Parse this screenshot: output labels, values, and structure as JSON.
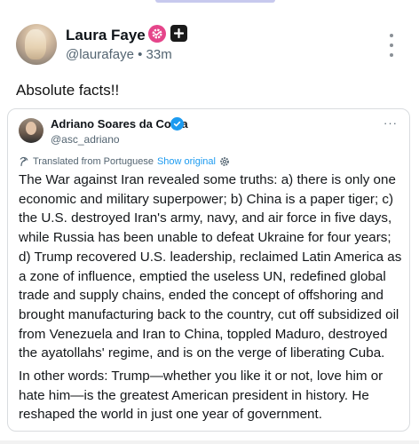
{
  "post": {
    "author_name": "Laura Faye",
    "handle": "@laurafaye",
    "separator": "•",
    "time_ago": "33m",
    "text": "Absolute facts!!",
    "icons": [
      "gear-badge-icon",
      "plus-box-icon",
      "more-vertical-icon"
    ]
  },
  "quote": {
    "author_name": "Adriano Soares da Costa",
    "handle": "@asc_adriano",
    "more": "···",
    "translated_label": "Translated from Portuguese",
    "show_original": "Show original",
    "paragraph_1": "The War against Iran revealed some truths: a) there is only one economic and military superpower; b) China is a paper tiger; c) the U.S. destroyed Iran's army, navy, and air force in five days, while Russia has been unable to defeat Ukraine for four years; d) Trump recovered U.S. leadership, reclaimed Latin America as a zone of influence, emptied the useless UN, redefined global trade and supply chains, ended the concept of offshoring and brought manufacturing back to the country, cut off subsidized oil from Venezuela and Iran to China, toppled Maduro, destroyed the ayatollahs' regime, and is on the verge of liberating Cuba.",
    "paragraph_2": "In other words: Trump—whether you like it or not, love him or hate him—is the greatest American president in history. He reshaped the world in just one year of government.",
    "icons": [
      "verified-check-icon",
      "translate-icon",
      "settings-icon"
    ]
  },
  "colors": {
    "link_blue": "#1d9bf0",
    "badge_pink": "#e5458a",
    "muted_text": "#536471"
  }
}
